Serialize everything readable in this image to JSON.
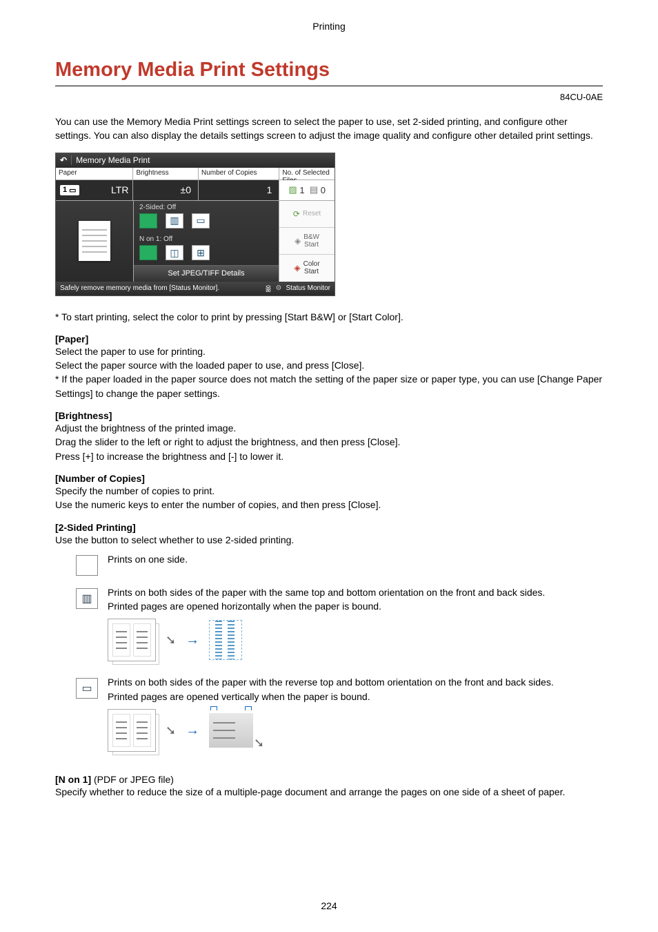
{
  "header": {
    "running_title": "Printing"
  },
  "title": "Memory Media Print Settings",
  "doc_code": "84CU-0AE",
  "intro": "You can use the Memory Media Print settings screen to select the paper to use, set 2-sided printing, and configure other settings. You can also display the details settings screen to adjust the image quality and configure other detailed print settings.",
  "device": {
    "titlebar": "Memory Media Print",
    "headers": {
      "paper": "Paper",
      "brightness": "Brightness",
      "copies": "Number of Copies",
      "files": "No. of Selected Files"
    },
    "values": {
      "tray": "1",
      "paper_size": "LTR",
      "brightness": "±0",
      "copies": "1",
      "files_img": "1",
      "files_pdf": "0"
    },
    "two_sided": {
      "label": "2-Sided: Off"
    },
    "n_on_1": {
      "label": "N on 1: Off"
    },
    "details_btn": "Set JPEG/TIFF Details",
    "side": {
      "reset": "Reset",
      "bw": "B&W\nStart",
      "color": "Color\nStart"
    },
    "statusbar": {
      "left": "Safely remove memory media from [Status Monitor].",
      "right": "Status Monitor"
    }
  },
  "lines": {
    "start_hint": "To start printing, select the color to print by pressing [Start B&W] or [Start Color].",
    "paper_h": "[Paper]",
    "paper_1": "Select the paper to use for printing.",
    "paper_2": "Select the paper source with the loaded paper to use, and press [Close].",
    "paper_3": "* If the paper loaded in the paper source does not match the setting of the paper size or paper type, you can use [Change Paper Settings] to change the paper settings.",
    "bright_h": "[Brightness]",
    "bright_1": "Adjust the brightness of the printed image.",
    "bright_2": "Drag the slider to the left or right to adjust the brightness, and then press [Close].",
    "bright_3": "Press [+] to increase the brightness and [-] to lower it.",
    "copies_h": "[Number of Copies]",
    "copies_1": "Specify the number of copies to print.",
    "copies_2": "Use the numeric keys to enter the number of copies, and then press [Close].",
    "twosided_h": "[2-Sided Printing]",
    "twosided_1": "Use the button to select whether to use 2-sided printing.",
    "opt1": "Prints on one side.",
    "opt2a": "Prints on both sides of the paper with the same top and bottom orientation on the front and back sides.",
    "opt2b": "Printed pages are opened horizontally when the paper is bound.",
    "opt3a": "Prints on both sides of the paper with the reverse top and bottom orientation on the front and back sides.",
    "opt3b": "Printed pages are opened vertically when the paper is bound.",
    "non1_h": "[N on 1] ",
    "non1_note": "(PDF or JPEG file)",
    "non1_1": "Specify whether to reduce the size of a multiple-page document and arrange the pages on one side of a sheet of paper."
  },
  "page_number": "224"
}
